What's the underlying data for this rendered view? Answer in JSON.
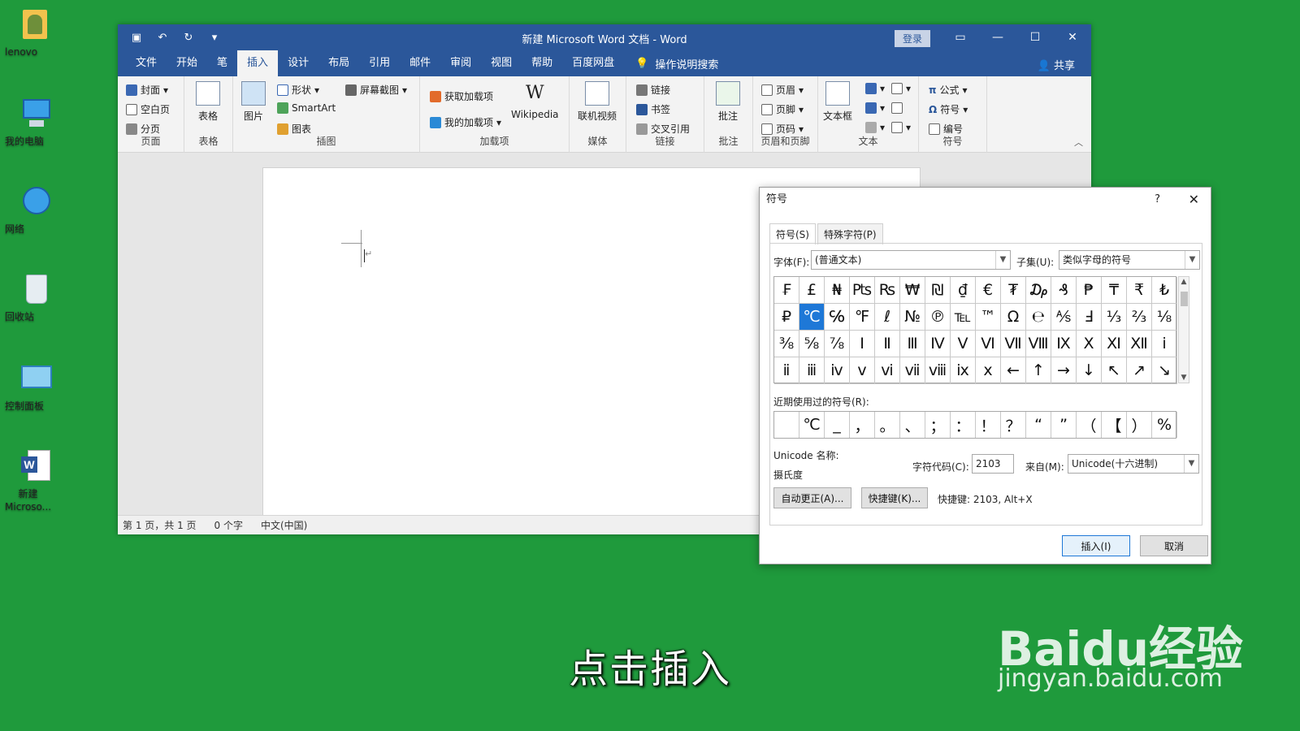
{
  "desktop": {
    "icons": [
      {
        "label": "lenovo"
      },
      {
        "label": "我的电脑"
      },
      {
        "label": "网络"
      },
      {
        "label": "回收站"
      },
      {
        "label": "控制面板"
      },
      {
        "label": "新建\nMicroso..."
      }
    ]
  },
  "word": {
    "title": "新建 Microsoft Word 文档 - Word",
    "login": "登录",
    "tabs": [
      "文件",
      "开始",
      "笔",
      "插入",
      "设计",
      "布局",
      "引用",
      "邮件",
      "审阅",
      "视图",
      "帮助",
      "百度网盘"
    ],
    "active_tab": "插入",
    "tell_me": "操作说明搜索",
    "share": "共享",
    "ribbon": {
      "page_group": {
        "name": "页面",
        "items": [
          "封面",
          "空白页",
          "分页"
        ]
      },
      "table_group": {
        "name": "表格",
        "big": "表格"
      },
      "illus_group": {
        "name": "插图",
        "big": "图片",
        "items": [
          "形状",
          "SmartArt",
          "图表",
          "屏幕截图"
        ]
      },
      "addin_group": {
        "name": "加载项",
        "items": [
          "获取加载项",
          "我的加载项"
        ],
        "big": "Wikipedia"
      },
      "media_group": {
        "name": "媒体",
        "big": "联机视频"
      },
      "link_group": {
        "name": "链接",
        "items": [
          "链接",
          "书签",
          "交叉引用"
        ]
      },
      "comment_group": {
        "name": "批注",
        "big": "批注"
      },
      "hf_group": {
        "name": "页眉和页脚",
        "items": [
          "页眉",
          "页脚",
          "页码"
        ]
      },
      "text_group": {
        "name": "文本",
        "big": "文本框"
      },
      "symbol_group": {
        "name": "符号",
        "items": [
          "公式",
          "符号",
          "编号"
        ]
      }
    },
    "status": {
      "page": "第 1 页，共 1 页",
      "words": "0 个字",
      "lang": "中文(中国)"
    }
  },
  "dialog": {
    "title": "符号",
    "help": "?",
    "tabs": [
      "符号(S)",
      "特殊字符(P)"
    ],
    "font_label": "字体(F):",
    "font_value": "(普通文本)",
    "subset_label": "子集(U):",
    "subset_value": "类似字母的符号",
    "symbols": [
      "₣",
      "£",
      "₦",
      "₧",
      "₨",
      "₩",
      "₪",
      "₫",
      "€",
      "₮",
      "₯",
      "₰",
      "₱",
      "₸",
      "₹",
      "₺",
      "₽",
      "℃",
      "℅",
      "℉",
      "ℓ",
      "№",
      "℗",
      "℡",
      "™",
      "Ω",
      "℮",
      "⅍",
      "Ⅎ",
      "⅓",
      "⅔",
      "⅛",
      "⅜",
      "⅝",
      "⅞",
      "Ⅰ",
      "Ⅱ",
      "Ⅲ",
      "Ⅳ",
      "Ⅴ",
      "Ⅵ",
      "Ⅶ",
      "Ⅷ",
      "Ⅸ",
      "Ⅹ",
      "Ⅺ",
      "Ⅻ",
      "ⅰ",
      "ⅱ",
      "ⅲ",
      "ⅳ",
      "ⅴ",
      "ⅵ",
      "ⅶ",
      "ⅷ",
      "ⅸ",
      "ⅹ",
      "←",
      "↑",
      "→",
      "↓",
      "↖",
      "↗",
      "↘"
    ],
    "selected_index": 17,
    "recent_label": "近期使用过的符号(R):",
    "recent": [
      " ",
      "℃",
      "_",
      "，",
      "。",
      "、",
      "；",
      "：",
      "！",
      "？",
      "“",
      "”",
      "（",
      "【",
      "）",
      "%"
    ],
    "unicode_name_label": "Unicode 名称:",
    "unicode_name": "摄氏度",
    "code_label": "字符代码(C):",
    "code_value": "2103",
    "from_label": "来自(M):",
    "from_value": "Unicode(十六进制)",
    "autocorrect": "自动更正(A)...",
    "shortcut_btn": "快捷键(K)...",
    "shortcut_text": "快捷键: 2103, Alt+X",
    "insert": "插入(I)",
    "cancel": "取消"
  },
  "caption": "点击插入",
  "watermark": {
    "brand": "Baidu经验",
    "url": "jingyan.baidu.com"
  }
}
